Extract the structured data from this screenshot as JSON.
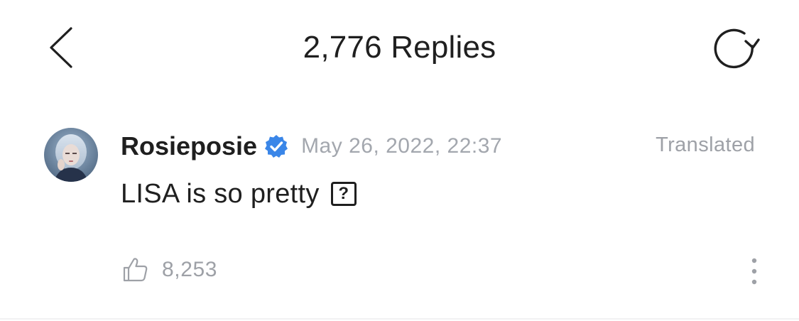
{
  "header": {
    "back_icon": "chevron-left-icon",
    "title": "2,776 Replies",
    "refresh_icon": "refresh-icon"
  },
  "comment": {
    "avatar_icon": "avatar",
    "username": "Rosieposie",
    "verified_icon": "verified-badge-icon",
    "timestamp": "May 26, 2022, 22:37",
    "translated_label": "Translated",
    "text": "LISA is so pretty",
    "unsupported_char": "?",
    "like_icon": "thumbs-up-icon",
    "like_count": "8,253",
    "more_icon": "more-vertical-icon"
  },
  "colors": {
    "text": "#1f1f1f",
    "muted": "#a3a7ae",
    "verified": "#3a86e8"
  }
}
